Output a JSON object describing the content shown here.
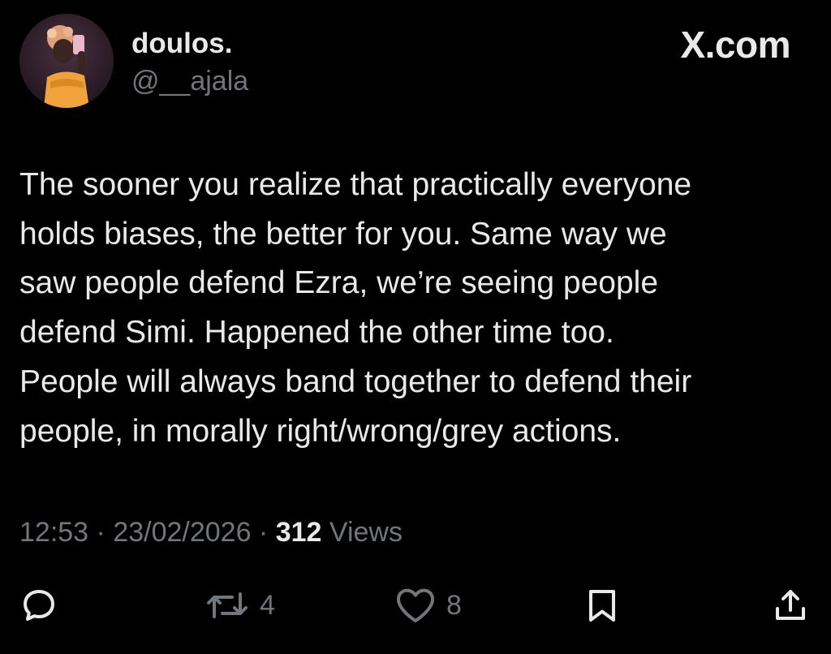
{
  "author": {
    "display_name": "doulos.",
    "handle": "@__ajala"
  },
  "brand": "X.com",
  "tweet": {
    "lines": [
      "The sooner you realize that practically everyone",
      "holds biases, the better for you. Same way we",
      "saw people defend Ezra, we’re seeing people",
      "defend Simi. Happened the other time too.",
      "People will always band together to defend their",
      "people, in morally right/wrong/grey actions."
    ]
  },
  "meta": {
    "time": "12:53",
    "separator": " · ",
    "date": "23/02/2026",
    "views_count": "312",
    "views_label": " Views"
  },
  "actions": {
    "reply": {
      "icon": "reply-icon"
    },
    "repost": {
      "icon": "repost-icon",
      "count": "4"
    },
    "like": {
      "icon": "heart-icon",
      "count": "8"
    },
    "bookmark": {
      "icon": "bookmark-icon"
    },
    "share": {
      "icon": "share-icon"
    }
  },
  "colors": {
    "background": "#000000",
    "text_primary": "#e7e9ea",
    "text_secondary": "#71767b",
    "avatar_outfit": "#f2a23a"
  }
}
